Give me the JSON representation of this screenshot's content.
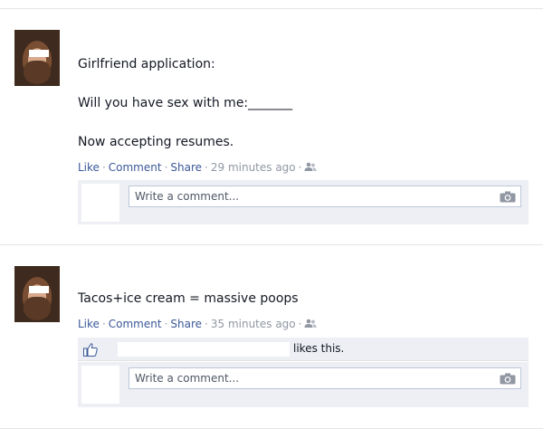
{
  "posts": [
    {
      "lines": [
        "Girlfriend application:",
        "Will you have sex with me:_______",
        "Now accepting resumes."
      ],
      "actions": {
        "like": "Like",
        "comment": "Comment",
        "share": "Share",
        "time": "29 minutes ago"
      },
      "comment_placeholder": "Write a comment..."
    },
    {
      "lines": [
        "Tacos+ice cream = massive poops"
      ],
      "actions": {
        "like": "Like",
        "comment": "Comment",
        "share": "Share",
        "time": "35 minutes ago"
      },
      "likes_text": "likes this.",
      "comment_placeholder": "Write a comment..."
    }
  ],
  "icons": {
    "audience": "friends-audience-icon",
    "camera": "camera-icon",
    "like": "thumbs-up-icon"
  },
  "colors": {
    "link": "#3b5998",
    "meta": "#9197a3",
    "comment_bg": "#edeff4",
    "input_border": "#bdc7d8"
  }
}
